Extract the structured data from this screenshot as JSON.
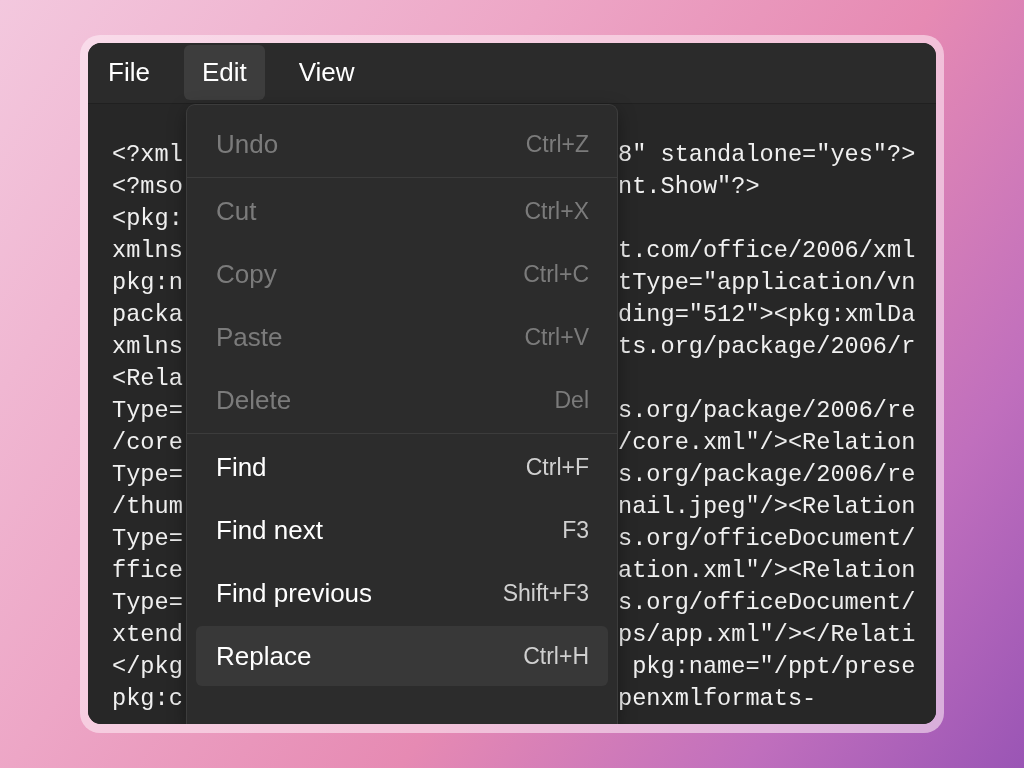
{
  "menubar": {
    "items": [
      {
        "label": "File",
        "selected": false
      },
      {
        "label": "Edit",
        "selected": true
      },
      {
        "label": "View",
        "selected": false
      }
    ]
  },
  "editor": {
    "lines": [
      {
        "left": "<?xml",
        "right": "8\" standalone=\"yes\"?>"
      },
      {
        "left": "<?mso",
        "right": "nt.Show\"?>"
      },
      {
        "left": "<pkg:"
      },
      {
        "left": "xmlns",
        "right": "t.com/office/2006/xml"
      },
      {
        "left": "pkg:n",
        "right": "tType=\"application/vn"
      },
      {
        "left": "packa",
        "right": "ding=\"512\"><pkg:xmlDa"
      },
      {
        "left": "xmlns",
        "right": "ts.org/package/2006/r"
      },
      {
        "left": "<Rela"
      },
      {
        "left": "Type=",
        "right": "s.org/package/2006/re"
      },
      {
        "left": "/core",
        "right": "/core.xml\"/><Relation"
      },
      {
        "left": "Type=",
        "right": "s.org/package/2006/re"
      },
      {
        "left": "/thum",
        "right": "nail.jpeg\"/><Relation"
      },
      {
        "left": "Type=",
        "right": "s.org/officeDocument/"
      },
      {
        "left": "ffice",
        "right": "ation.xml\"/><Relation"
      },
      {
        "left": "Type=",
        "right": "s.org/officeDocument/"
      },
      {
        "left": "xtend",
        "right": "ps/app.xml\"/></Relati"
      },
      {
        "left": "</pkg",
        "right": " pkg:name=\"/ppt/prese"
      },
      {
        "left": "pkg:c",
        "right": "penxmlformats-"
      }
    ]
  },
  "edit_menu": {
    "groups": [
      {
        "items": [
          {
            "label": "Undo",
            "shortcut": "Ctrl+Z",
            "disabled": true,
            "selected": false
          }
        ]
      },
      {
        "items": [
          {
            "label": "Cut",
            "shortcut": "Ctrl+X",
            "disabled": true,
            "selected": false
          },
          {
            "label": "Copy",
            "shortcut": "Ctrl+C",
            "disabled": true,
            "selected": false
          },
          {
            "label": "Paste",
            "shortcut": "Ctrl+V",
            "disabled": true,
            "selected": false
          },
          {
            "label": "Delete",
            "shortcut": "Del",
            "disabled": true,
            "selected": false
          }
        ]
      },
      {
        "items": [
          {
            "label": "Find",
            "shortcut": "Ctrl+F",
            "disabled": false,
            "selected": false
          },
          {
            "label": "Find next",
            "shortcut": "F3",
            "disabled": false,
            "selected": false
          },
          {
            "label": "Find previous",
            "shortcut": "Shift+F3",
            "disabled": false,
            "selected": false
          },
          {
            "label": "Replace",
            "shortcut": "Ctrl+H",
            "disabled": false,
            "selected": true
          }
        ]
      }
    ]
  }
}
